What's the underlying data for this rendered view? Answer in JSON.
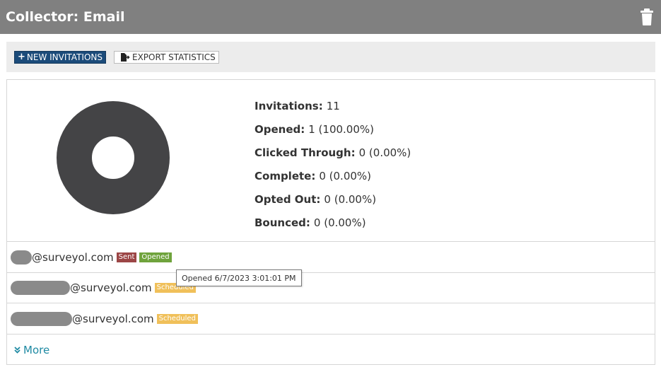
{
  "header": {
    "title": "Collector: Email"
  },
  "toolbar": {
    "new_invitations": "NEW INVITATIONS",
    "export_statistics": "EXPORT STATISTICS"
  },
  "stats": [
    {
      "label": "Invitations:",
      "value": "11"
    },
    {
      "label": "Opened:",
      "value": "1 (100.00%)"
    },
    {
      "label": "Clicked Through:",
      "value": "0 (0.00%)"
    },
    {
      "label": "Complete:",
      "value": "0 (0.00%)"
    },
    {
      "label": "Opted Out:",
      "value": "0 (0.00%)"
    },
    {
      "label": "Bounced:",
      "value": "0 (0.00%)"
    }
  ],
  "recipients": [
    {
      "email_domain": "@surveyol.com",
      "badges": [
        "Sent",
        "Opened"
      ]
    },
    {
      "email_domain": "@surveyol.com",
      "badges": [
        "Scheduled"
      ]
    },
    {
      "email_domain": "@surveyol.com",
      "badges": [
        "Scheduled"
      ]
    }
  ],
  "more_label": "More",
  "tooltip": "Opened 6/7/2023 3:01:01 PM",
  "colors": {
    "header_bg": "#808080",
    "primary_button": "#1b4b7a",
    "donut": "#444446",
    "badge_sent": "#9c4646",
    "badge_opened": "#6fa33c",
    "badge_scheduled": "#f0c05a",
    "link": "#1f8aa3"
  },
  "icons": {
    "delete": "trash-icon",
    "new": "plus-icon",
    "export": "export-file-icon",
    "more": "double-chevron-down-icon"
  }
}
